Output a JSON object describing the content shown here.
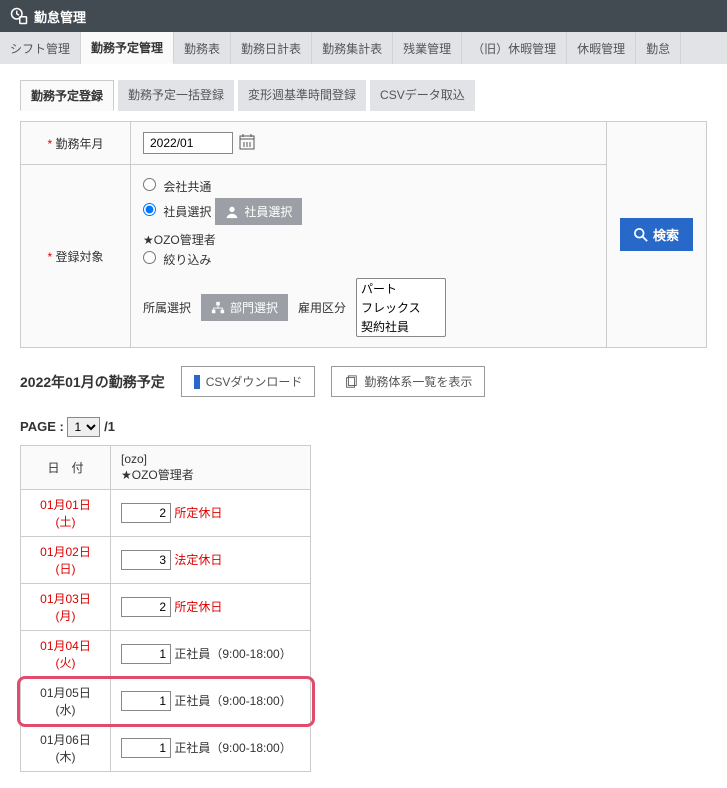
{
  "app": {
    "title": "勤怠管理"
  },
  "nav": {
    "tabs": [
      {
        "label": "シフト管理"
      },
      {
        "label": "勤務予定管理",
        "active": true
      },
      {
        "label": "勤務表"
      },
      {
        "label": "勤務日計表"
      },
      {
        "label": "勤務集計表"
      },
      {
        "label": "残業管理"
      },
      {
        "label": "（旧）休暇管理"
      },
      {
        "label": "休暇管理"
      },
      {
        "label": "勤怠"
      }
    ]
  },
  "subnav": {
    "tabs": [
      {
        "label": "勤務予定登録",
        "active": true
      },
      {
        "label": "勤務予定一括登録"
      },
      {
        "label": "変形週基準時間登録"
      },
      {
        "label": "CSVデータ取込"
      }
    ]
  },
  "form": {
    "month_label": "勤務年月",
    "month_value": "2022/01",
    "target_label": "登録対象",
    "radios": {
      "company": "会社共通",
      "employee": "社員選択",
      "filter": "絞り込み"
    },
    "employee_select_btn": "社員選択",
    "star_role": "★OZO管理者",
    "dept_label": "所属選択",
    "dept_btn": "部門選択",
    "emp_type_label": "雇用区分",
    "emp_type_options": [
      "パート",
      "フレックス",
      "契約社員"
    ],
    "search_btn": "検索"
  },
  "list_header": {
    "title": "2022年01月の勤務予定",
    "csv_btn": "CSVダウンロード",
    "pattern_btn": "勤務体系一覧を表示"
  },
  "pager": {
    "prefix": "PAGE :",
    "options": [
      "1"
    ],
    "total": "/1"
  },
  "table": {
    "headers": {
      "date": "日　付",
      "ozo_id": "[ozo]",
      "ozo_role": "★OZO管理者"
    },
    "rows": [
      {
        "date": "01月01日 (土)",
        "value": "2",
        "status": "所定休日",
        "holiday": true
      },
      {
        "date": "01月02日 (日)",
        "value": "3",
        "status": "法定休日",
        "holiday": true
      },
      {
        "date": "01月03日 (月)",
        "value": "2",
        "status": "所定休日",
        "holiday": true
      },
      {
        "date": "01月04日 (火)",
        "value": "1",
        "status": "正社員（9:00-18:00）",
        "holiday": true
      },
      {
        "date": "01月05日 (水)",
        "value": "1",
        "status": "正社員（9:00-18:00）",
        "holiday": false,
        "highlight": true
      },
      {
        "date": "01月06日 (木)",
        "value": "1",
        "status": "正社員（9:00-18:00）",
        "holiday": false
      }
    ]
  }
}
